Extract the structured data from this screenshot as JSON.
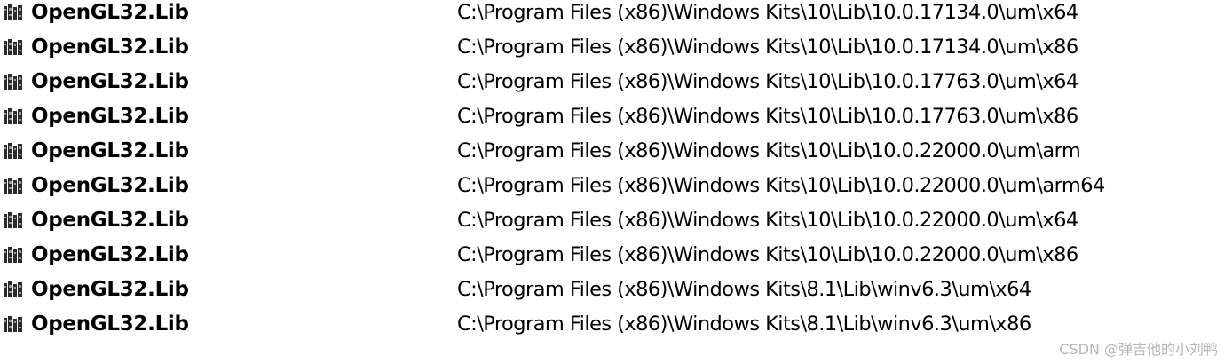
{
  "results": [
    {
      "name": "OpenGL32.Lib",
      "path": "C:\\Program Files (x86)\\Windows Kits\\10\\Lib\\10.0.17134.0\\um\\x64",
      "icon": "library-icon"
    },
    {
      "name": "OpenGL32.Lib",
      "path": "C:\\Program Files (x86)\\Windows Kits\\10\\Lib\\10.0.17134.0\\um\\x86",
      "icon": "library-icon"
    },
    {
      "name": "OpenGL32.Lib",
      "path": "C:\\Program Files (x86)\\Windows Kits\\10\\Lib\\10.0.17763.0\\um\\x64",
      "icon": "library-icon"
    },
    {
      "name": "OpenGL32.Lib",
      "path": "C:\\Program Files (x86)\\Windows Kits\\10\\Lib\\10.0.17763.0\\um\\x86",
      "icon": "library-icon"
    },
    {
      "name": "OpenGL32.Lib",
      "path": "C:\\Program Files (x86)\\Windows Kits\\10\\Lib\\10.0.22000.0\\um\\arm",
      "icon": "library-icon"
    },
    {
      "name": "OpenGL32.Lib",
      "path": "C:\\Program Files (x86)\\Windows Kits\\10\\Lib\\10.0.22000.0\\um\\arm64",
      "icon": "library-icon"
    },
    {
      "name": "OpenGL32.Lib",
      "path": "C:\\Program Files (x86)\\Windows Kits\\10\\Lib\\10.0.22000.0\\um\\x64",
      "icon": "library-icon"
    },
    {
      "name": "OpenGL32.Lib",
      "path": "C:\\Program Files (x86)\\Windows Kits\\10\\Lib\\10.0.22000.0\\um\\x86",
      "icon": "library-icon"
    },
    {
      "name": "OpenGL32.Lib",
      "path": "C:\\Program Files (x86)\\Windows Kits\\8.1\\Lib\\winv6.3\\um\\x64",
      "icon": "library-icon"
    },
    {
      "name": "OpenGL32.Lib",
      "path": "C:\\Program Files (x86)\\Windows Kits\\8.1\\Lib\\winv6.3\\um\\x86",
      "icon": "library-icon"
    }
  ],
  "watermark": "CSDN @弹吉他的小刘鸭",
  "colors": {
    "text": "#000000",
    "icon_dark": "#2b2b2b",
    "icon_light": "#9a9a9a",
    "watermark": "#b6b6b6",
    "background": "#ffffff"
  }
}
